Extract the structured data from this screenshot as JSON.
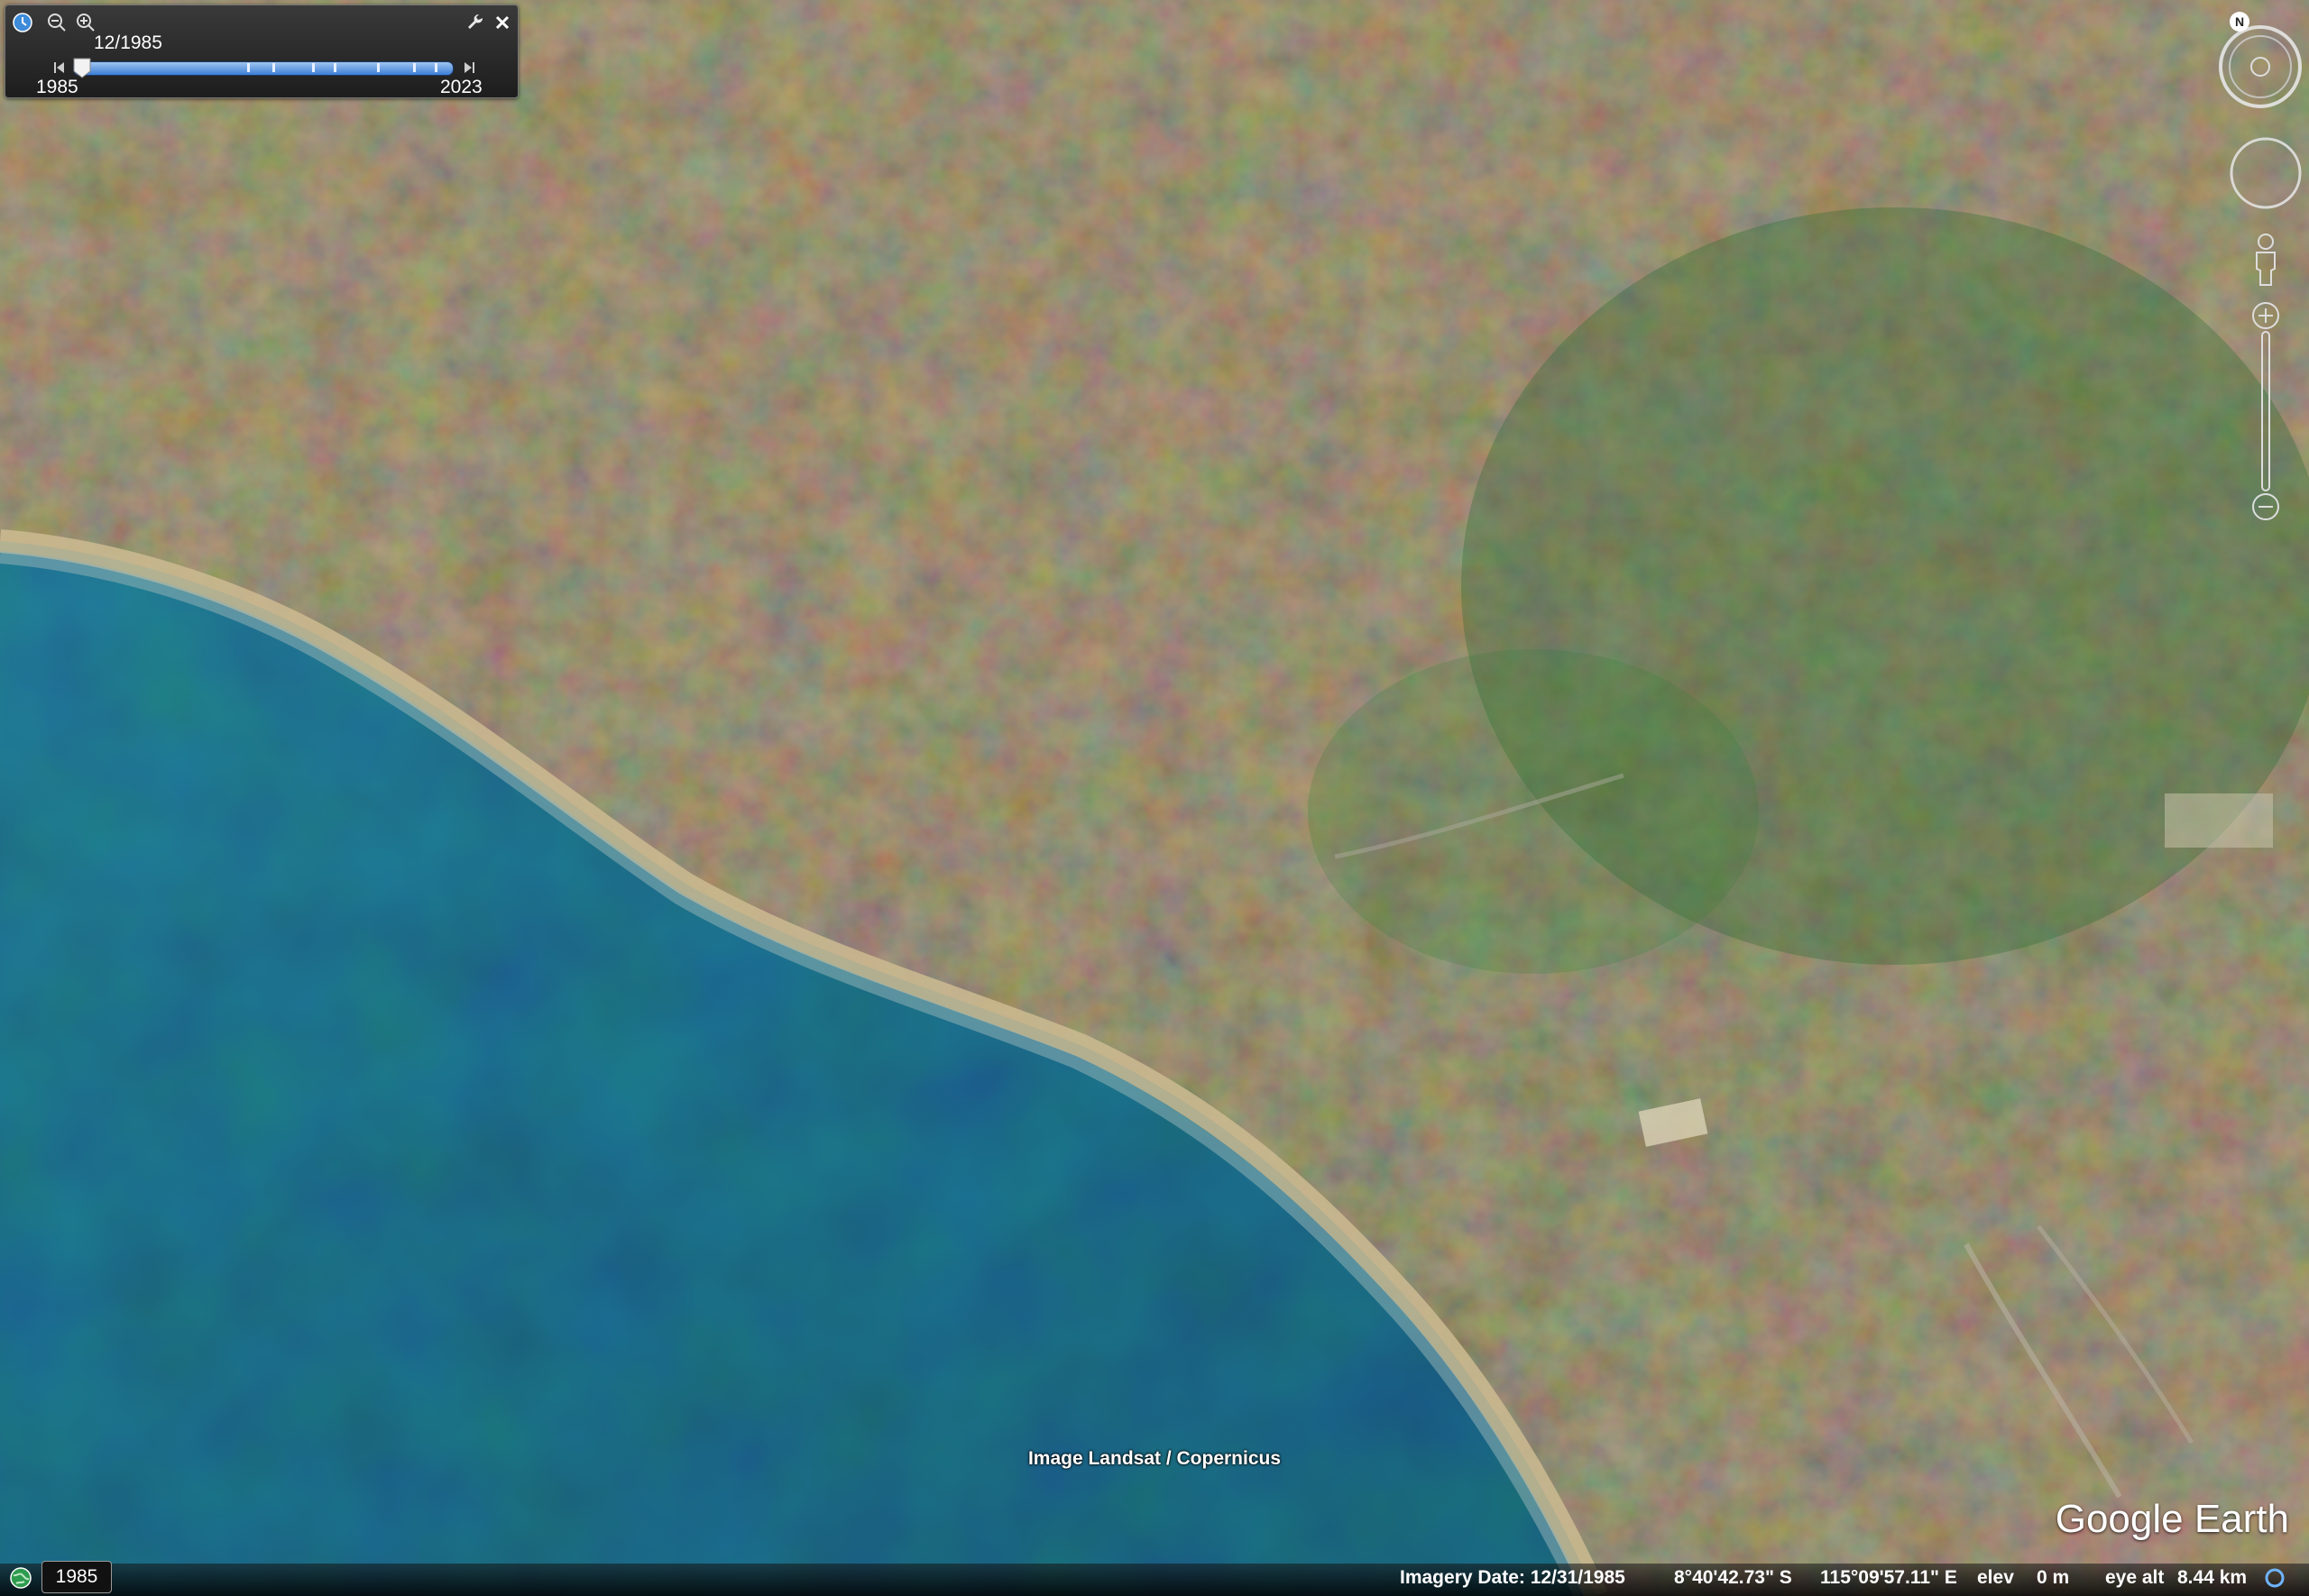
{
  "time_slider": {
    "current_date": "12/1985",
    "start_year": "1985",
    "end_year": "2023",
    "position_fraction": 0.0
  },
  "map": {
    "credit": "Image Landsat / Copernicus",
    "logo": "Google Earth",
    "colors": {
      "sea": "#0f4a63",
      "coast": "#c9b58a",
      "land": "#5e7046"
    }
  },
  "status_bar": {
    "year_badge": "1985",
    "imagery_date": "Imagery Date: 12/31/1985",
    "latitude": "8°40'42.73\" S",
    "longitude": "115°09'57.11\" E",
    "elev_label": "elev",
    "elev_value": "0 m",
    "eye_alt_label": "eye alt",
    "eye_alt_value": "8.44 km"
  },
  "icons": {
    "history": "clock-icon",
    "zoom_out": "zoom-out-icon",
    "zoom_in": "zoom-in-icon",
    "settings": "wrench-icon",
    "close": "close-icon",
    "compass": "compass-north-icon",
    "look": "look-joystick-icon",
    "street_view": "pegman-icon",
    "zoom_slider": "zoom-slider-icon",
    "globe": "globe-icon",
    "loading": "loading-ring-icon"
  }
}
